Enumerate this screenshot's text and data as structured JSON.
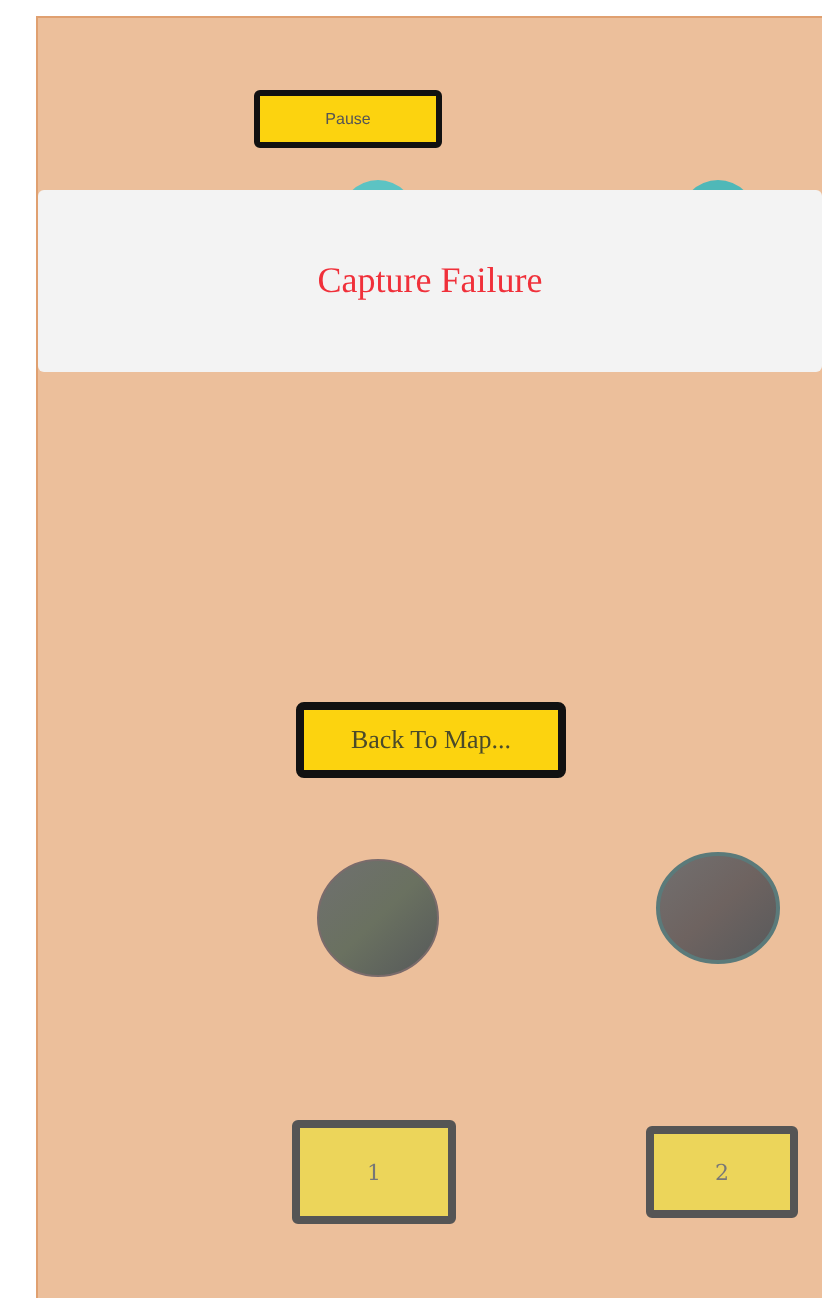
{
  "pause_button": {
    "label": "Pause"
  },
  "banner": {
    "title": "Capture Failure"
  },
  "back_button": {
    "label": "Back To Map..."
  },
  "number_buttons": [
    {
      "label": "1"
    },
    {
      "label": "2"
    }
  ]
}
